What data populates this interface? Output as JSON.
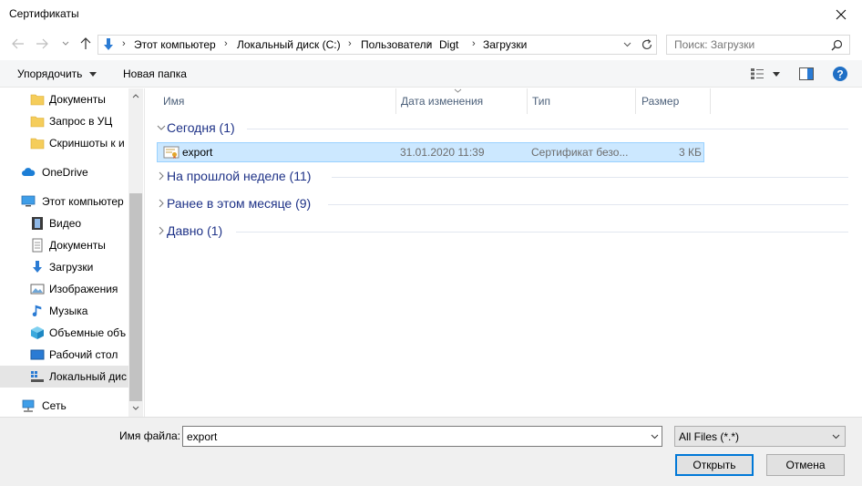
{
  "window": {
    "title": "Сертификаты"
  },
  "breadcrumb": [
    "Этот компьютер",
    "Локальный диск (C:)",
    "Пользователи",
    "Digt",
    "Загрузки"
  ],
  "search": {
    "placeholder": "Поиск: Загрузки"
  },
  "toolbar": {
    "organize_label": "Упорядочить",
    "new_folder_label": "Новая папка"
  },
  "sidebar": {
    "items": [
      {
        "label": "Документы",
        "icon": "folder-icon",
        "level": "sub"
      },
      {
        "label": "Запрос в УЦ",
        "icon": "folder-icon",
        "level": "sub"
      },
      {
        "label": "Скриншоты к и",
        "icon": "folder-icon",
        "level": "sub"
      },
      {
        "label": "OneDrive",
        "icon": "cloud-icon",
        "level": "top"
      },
      {
        "label": "Этот компьютер",
        "icon": "computer-icon",
        "level": "top"
      },
      {
        "label": "Видео",
        "icon": "video-icon",
        "level": "sub"
      },
      {
        "label": "Документы",
        "icon": "documents-icon",
        "level": "sub"
      },
      {
        "label": "Загрузки",
        "icon": "download-icon",
        "level": "sub"
      },
      {
        "label": "Изображения",
        "icon": "pictures-icon",
        "level": "sub"
      },
      {
        "label": "Музыка",
        "icon": "music-icon",
        "level": "sub"
      },
      {
        "label": "Объемные объ",
        "icon": "3d-objects-icon",
        "level": "sub"
      },
      {
        "label": "Рабочий стол",
        "icon": "desktop-icon",
        "level": "sub"
      },
      {
        "label": "Локальный дис",
        "icon": "drive-icon",
        "level": "sub",
        "selected": true
      },
      {
        "label": "Сеть",
        "icon": "network-icon",
        "level": "top"
      }
    ]
  },
  "columns": {
    "name": "Имя",
    "date": "Дата изменения",
    "type": "Тип",
    "size": "Размер"
  },
  "groups": [
    {
      "label": "Сегодня (1)",
      "expanded": true
    },
    {
      "label": "На прошлой неделе (11)",
      "expanded": false
    },
    {
      "label": "Ранее в этом месяце (9)",
      "expanded": false
    },
    {
      "label": "Давно (1)",
      "expanded": false
    }
  ],
  "files": [
    {
      "name": "export",
      "date": "31.01.2020 11:39",
      "type": "Сертификат безо...",
      "size": "3 КБ",
      "icon": "certificate-icon"
    }
  ],
  "footer": {
    "filename_label": "Имя файла:",
    "filename_value": "export",
    "filter_value": "All Files (*.*)",
    "open_label": "Открыть",
    "cancel_label": "Отмена"
  },
  "colors": {
    "accent": "#0078d7",
    "selection": "#cce8ff",
    "group_text": "#1e3287"
  }
}
